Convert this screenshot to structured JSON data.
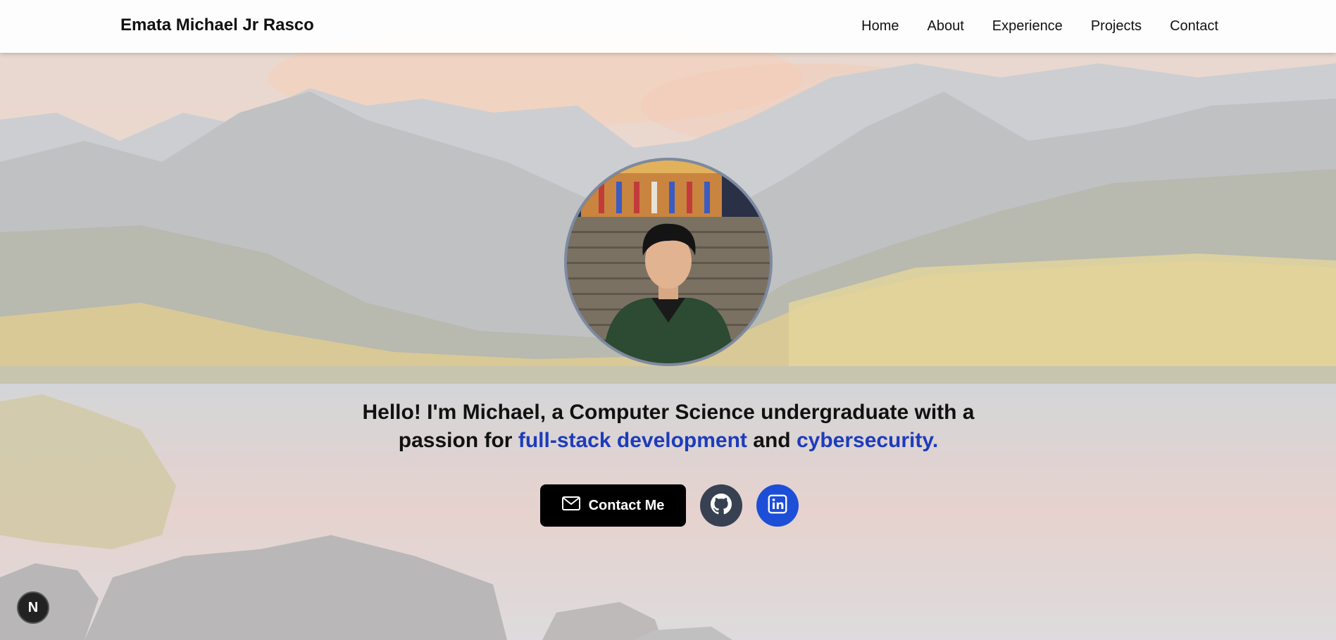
{
  "navbar": {
    "brand": "Emata Michael Jr Rasco",
    "links": [
      "Home",
      "About",
      "Experience",
      "Projects",
      "Contact"
    ]
  },
  "hero": {
    "intro_prefix": "Hello! I'm Michael, a Computer Science undergraduate with a passion for",
    "highlight_1": "full-stack development",
    "connector": "and",
    "highlight_2": "cybersecurity.",
    "accent_color": "#1d3cbc"
  },
  "actions": {
    "contact_label": "Contact Me",
    "contact_icon": "mail-icon",
    "github_icon": "github-icon",
    "linkedin_icon": "linkedin-icon"
  },
  "dev_badge": {
    "label": "N",
    "icon": "nextjs-icon"
  },
  "colors": {
    "contact_button": "#000000",
    "github_button": "#374151",
    "linkedin_button": "#1d4ed8",
    "avatar_border": "#7d8aa0"
  }
}
